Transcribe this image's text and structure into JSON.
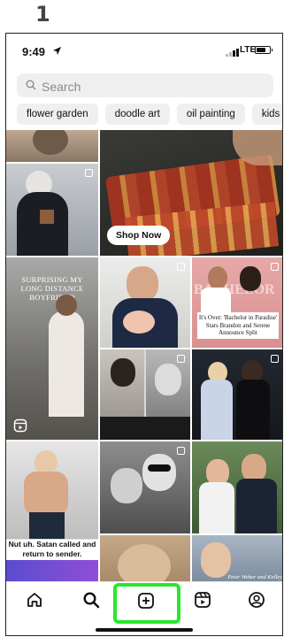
{
  "step_number": "1",
  "status_bar": {
    "time": "9:49",
    "network": "LTE"
  },
  "search": {
    "placeholder": "Search"
  },
  "chips": [
    "flower garden",
    "doodle art",
    "oil painting",
    "kids crafts"
  ],
  "posts": {
    "shop_now_label": "Shop Now",
    "overlay_surprising": "SURPRISING MY LONG DISTANCE BOYFRIEND",
    "overlay_bachelor_headline": "It's Over: 'Bachelor in Paradise' Stars Brandon and Serene Announce Split",
    "overlay_satan": "Nut uh. Satan called and return to sender.",
    "overlay_bachelor_bg": "BACHELOR",
    "overlay_peter_credit": "Peter Weber and Kelley"
  },
  "colors": {
    "highlight": "#27e82b"
  },
  "icons": {
    "status_arrow": "location-arrow-icon",
    "signal": "signal-icon",
    "battery": "battery-icon",
    "search": "search-icon",
    "multi_post": "multi-post-icon",
    "reels": "reels-icon",
    "nav_home": "home-icon",
    "nav_search": "search-icon",
    "nav_create": "create-icon",
    "nav_reels": "reels-icon",
    "nav_profile": "profile-icon"
  }
}
